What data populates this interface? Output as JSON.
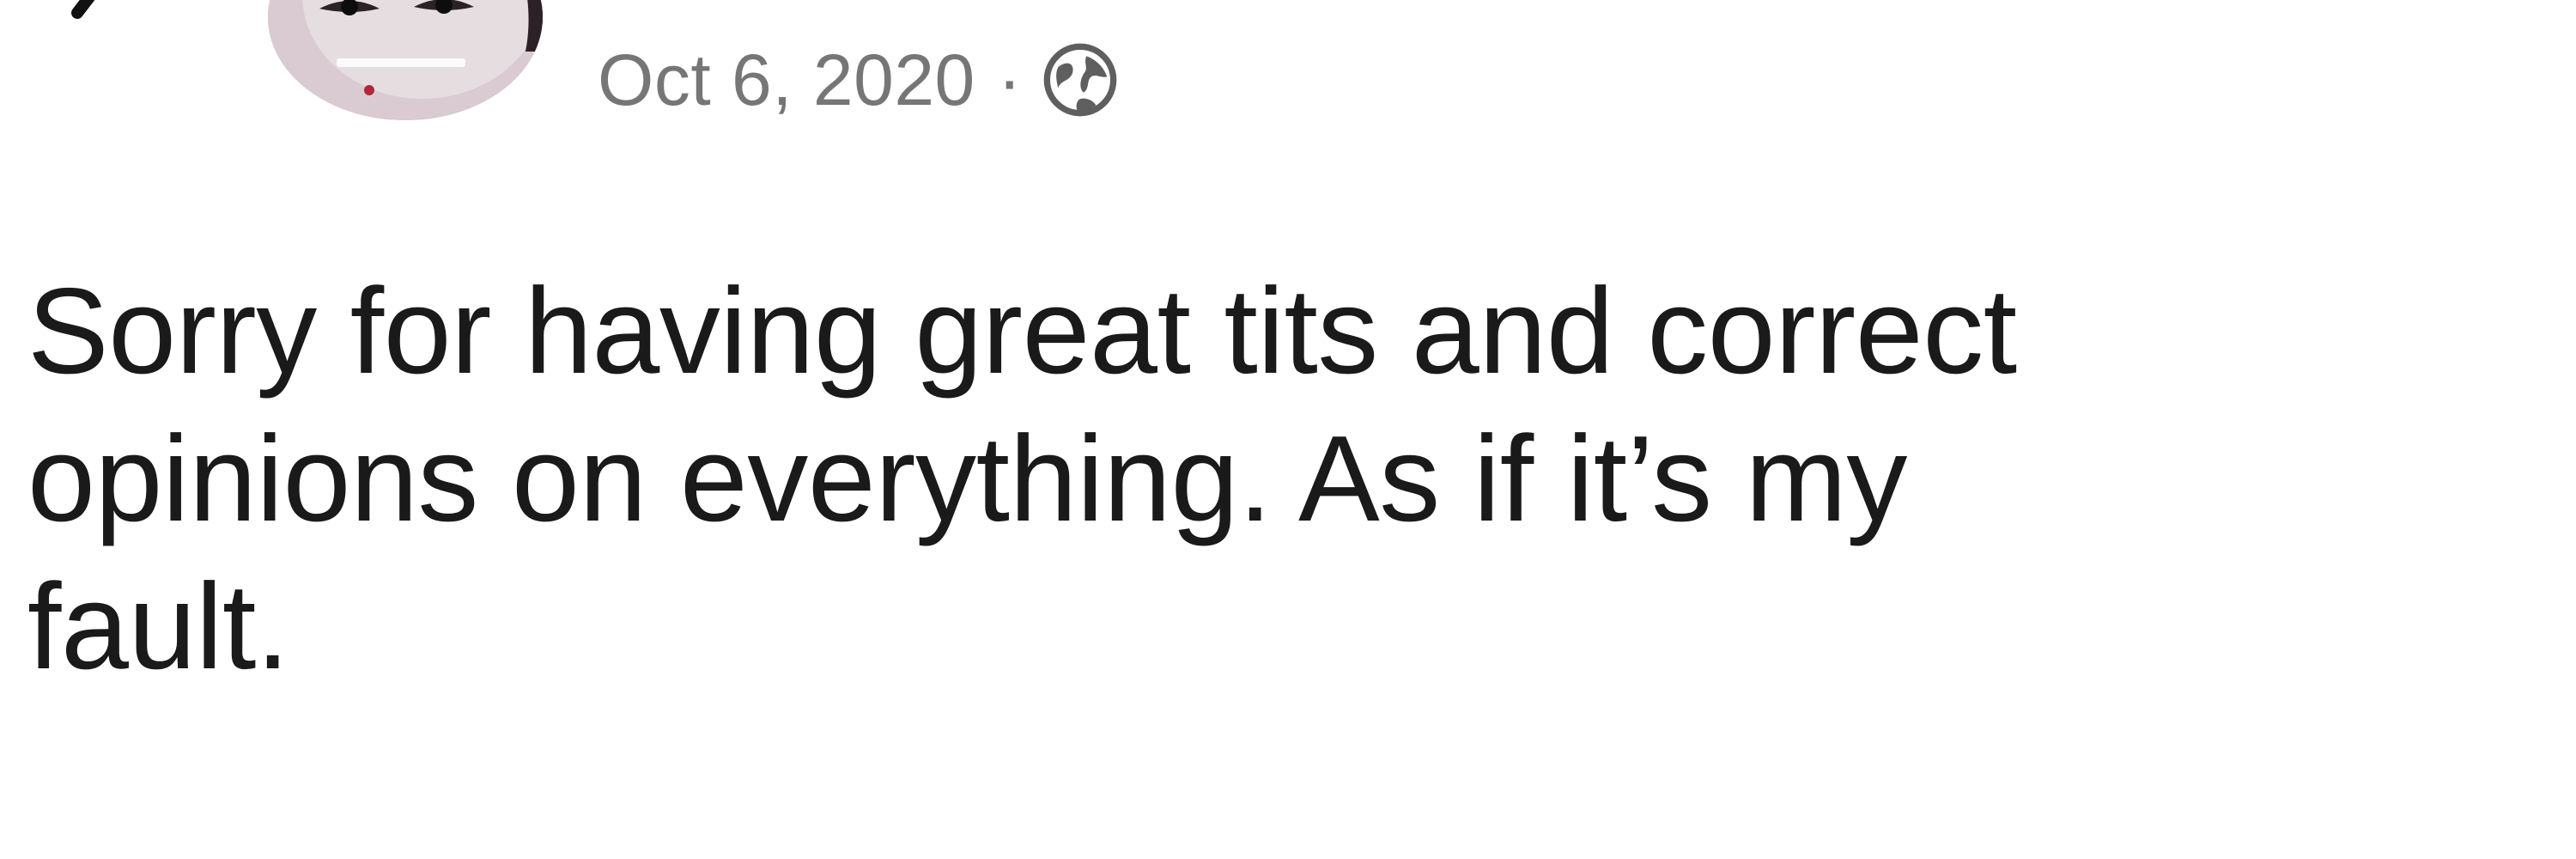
{
  "post": {
    "timestamp": "Oct 6, 2020",
    "separator": "·",
    "audience_icon": "globe-icon",
    "text": "Sorry for having great tits and correct\nopinions on everything. As if it’s my\nfault."
  },
  "header": {
    "back_icon": "back-chevron-icon",
    "avatar_icon": "avatar"
  }
}
